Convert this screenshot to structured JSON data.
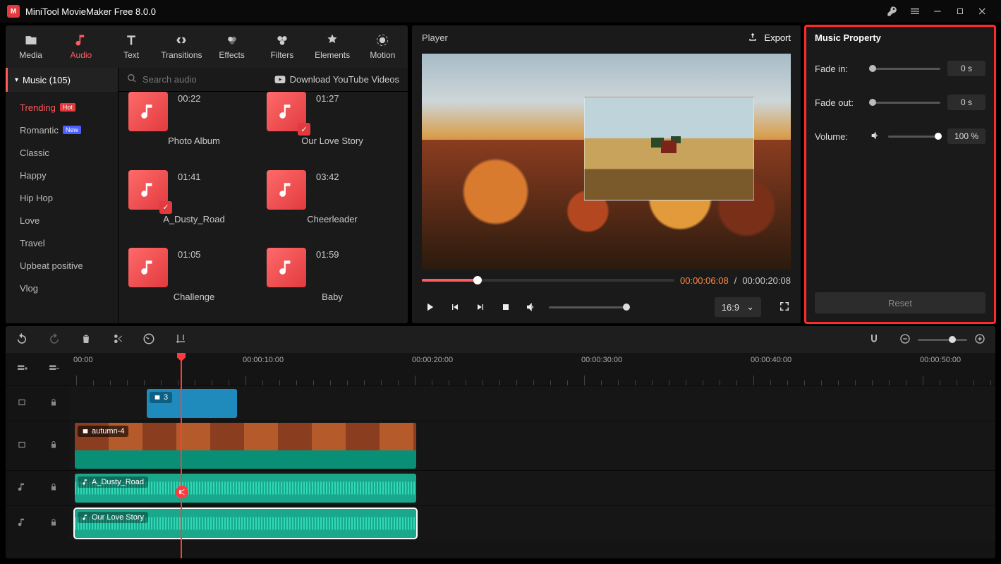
{
  "titlebar": {
    "app_title": "MiniTool MovieMaker Free 8.0.0"
  },
  "nav": {
    "media": "Media",
    "audio": "Audio",
    "text": "Text",
    "transitions": "Transitions",
    "effects": "Effects",
    "filters": "Filters",
    "elements": "Elements",
    "motion": "Motion"
  },
  "sidebar": {
    "header": "Music (105)",
    "categories": [
      {
        "label": "Trending",
        "badge": "Hot",
        "active": true
      },
      {
        "label": "Romantic",
        "badge": "New"
      },
      {
        "label": "Classic"
      },
      {
        "label": "Happy"
      },
      {
        "label": "Hip Hop"
      },
      {
        "label": "Love"
      },
      {
        "label": "Travel"
      },
      {
        "label": "Upbeat positive"
      },
      {
        "label": "Vlog"
      }
    ]
  },
  "search": {
    "placeholder": "Search audio",
    "yt": "Download YouTube Videos"
  },
  "audio_items": [
    {
      "name": "Photo Album",
      "dur": "00:22",
      "checked": false
    },
    {
      "name": "Our Love Story",
      "dur": "01:27",
      "checked": true
    },
    {
      "name": "A_Dusty_Road",
      "dur": "01:41",
      "checked": true
    },
    {
      "name": "Cheerleader",
      "dur": "03:42",
      "checked": false
    },
    {
      "name": "Challenge",
      "dur": "01:05",
      "checked": false
    },
    {
      "name": "Baby",
      "dur": "01:59",
      "checked": false
    }
  ],
  "player": {
    "title": "Player",
    "export": "Export",
    "cur": "00:00:06:08",
    "tot": "00:00:20:08",
    "aspect": "16:9"
  },
  "prop": {
    "title": "Music Property",
    "fade_in_label": "Fade in:",
    "fade_in": "0 s",
    "fade_out_label": "Fade out:",
    "fade_out": "0 s",
    "volume_label": "Volume:",
    "volume": "100 %",
    "reset": "Reset"
  },
  "timeline": {
    "labels": [
      "00:00",
      "00:00:10:00",
      "00:00:20:00",
      "00:00:30:00",
      "00:00:40:00",
      "00:00:50:00"
    ],
    "pip_count": "3",
    "video_name": "autumn-4",
    "audio1": "A_Dusty_Road",
    "audio2": "Our Love Story"
  }
}
